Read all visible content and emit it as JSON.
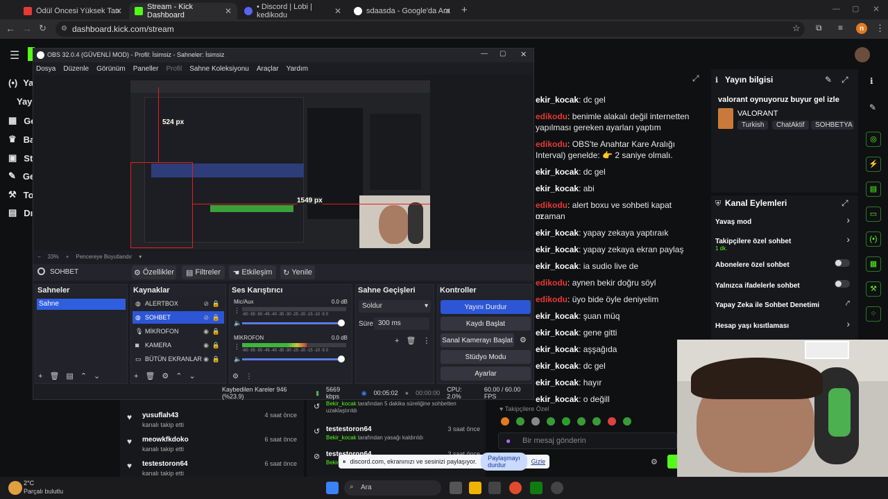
{
  "browser": {
    "tabs": [
      {
        "title": "Ödül Öncesi Yüksek Tansiyon! |",
        "color": "#e53935"
      },
      {
        "title": "Stream - Kick Dashboard",
        "color": "#53fc18"
      },
      {
        "title": "• Discord | Lobi | kedikodu",
        "color": "#5865f2"
      },
      {
        "title": "sdaasda - Google'da Ara",
        "color": "#ffffff"
      }
    ],
    "url": "dashboard.kick.com/stream",
    "profile_initial": "n"
  },
  "kick": {
    "sidebar": [
      "Yay",
      "Yayı",
      "Ge",
      "Ba",
      "St",
      "Ge",
      "To",
      "Dı"
    ],
    "chat": [
      {
        "user": "ekir_kocak",
        "color": "#ffffff",
        "msg": "dc gel"
      },
      {
        "user": "edikodu",
        "color": "#e53935",
        "msg": "benimle alakalı değil internetten"
      },
      {
        "user": "",
        "color": "#fff",
        "msg": "yapılması gereken ayarları yaptım"
      },
      {
        "user": "edikodu",
        "color": "#e53935",
        "msg": "OBS'te Anahtar Kare Aralığı"
      },
      {
        "user": "",
        "color": "#fff",
        "msg": "Interval) genelde: 👉 2 saniye olmalı."
      },
      {
        "user": "ekir_kocak",
        "color": "#ffffff",
        "msg": "dc gel"
      },
      {
        "user": "ekir_kocak",
        "color": "#ffffff",
        "msg": "abi"
      },
      {
        "user": "edikodu",
        "color": "#e53935",
        "msg": "alert boxu ve sohbeti kapat ozaman"
      },
      {
        "user": "",
        "color": "#fff",
        "msg": "m"
      },
      {
        "user": "ekir_kocak",
        "color": "#ffffff",
        "msg": "yapay zekaya yaptıraık"
      },
      {
        "user": "ekir_kocak",
        "color": "#ffffff",
        "msg": "yapay zekaya ekran paylaş"
      },
      {
        "user": "ekir_kocak",
        "color": "#ffffff",
        "msg": "ia sudio live de"
      },
      {
        "user": "edikodu",
        "color": "#e53935",
        "msg": "aynen bekir doğru söyl"
      },
      {
        "user": "edikodu",
        "color": "#e53935",
        "msg": "üyo bide öyle deniyelim"
      },
      {
        "user": "ekir_kocak",
        "color": "#ffffff",
        "msg": "şuan müq"
      },
      {
        "user": "ekir_kocak",
        "color": "#ffffff",
        "msg": "gene gitti"
      },
      {
        "user": "ekir_kocak",
        "color": "#ffffff",
        "msg": "aşşağıda"
      },
      {
        "user": "ekir_kocak",
        "color": "#ffffff",
        "msg": "dc gel"
      },
      {
        "user": "ekir_kocak",
        "color": "#ffffff",
        "msg": "hayır"
      },
      {
        "user": "ekir_kocak",
        "color": "#ffffff",
        "msg": "o değill"
      }
    ],
    "chat_input_placeholder": "Bir mesaj gönderin",
    "chat_followers_label": "Takipçilere Özel",
    "stream_info": {
      "heading": "Yayın bilgisi",
      "title": "valorant oynuyoruz buyur gel izle",
      "category": "VALORANT",
      "tags": [
        "Turkish",
        "ChatAktif",
        "SOHBETYA"
      ]
    },
    "channel_actions": {
      "heading": "Kanal Eylemleri",
      "items": [
        {
          "label": "Yavaş mod",
          "sub": "",
          "control": "arrow"
        },
        {
          "label": "Takipçilere özel sohbet",
          "sub": "1 dk.",
          "control": "arrow"
        },
        {
          "label": "Abonelere özel sohbet",
          "sub": "",
          "control": "toggle"
        },
        {
          "label": "Yalnızca ifadelerle sohbet",
          "sub": "",
          "control": "toggle"
        },
        {
          "label": "Yapay Zeka ile Sohbet Denetimi",
          "sub": "",
          "control": "external"
        },
        {
          "label": "Hesap yaşı kısıtlaması",
          "sub": "",
          "control": "arrow"
        }
      ]
    },
    "activity_left": [
      {
        "user": "yusuflah43",
        "action": "kanalı takip etti",
        "time": "4 saat önce"
      },
      {
        "user": "meowkfkdoko",
        "action": "kanalı takip etti",
        "time": "6 saat önce"
      },
      {
        "user": "testestoron64",
        "action": "kanalı takip etti",
        "time": "6 saat önce"
      }
    ],
    "activity_right": [
      {
        "user": "",
        "action": "tarafından 5 dakika süreliğine sohbetten uzaklaştırıldı",
        "by": "Bekir_kocak",
        "time": ""
      },
      {
        "user": "testestoron64",
        "action": "tarafından yasağı kaldırıldı",
        "by": "Bekir_kocak",
        "time": "3 saat önce"
      },
      {
        "user": "testestoron64",
        "action": "",
        "by": "Bekir_kocak",
        "time": "3 saat önce"
      }
    ]
  },
  "share_bar": {
    "text": "discord.com, ekranınızı ve sesinizi paylaşıyor.",
    "stop": "Paylaşmayı durdur",
    "hide": "Gizle"
  },
  "obs": {
    "title": "OBS 32.0.4 (GÜVENLİ MOD) - Profil: İsimsiz - Sahneler: İsimsiz",
    "menu": [
      "Dosya",
      "Düzenle",
      "Görünüm",
      "Paneller",
      "Profil",
      "Sahne Koleksiyonu",
      "Araçlar",
      "Yardım"
    ],
    "preview_labels": {
      "w": "524 px",
      "h": "1549 px"
    },
    "zoom": "33%",
    "fit": "Pencereye Boyutlandır",
    "source_bar": {
      "selected": "SOHBET",
      "props": "Özellikler",
      "filters": "Filtreler",
      "interact": "Etkileşim",
      "refresh": "Yenile"
    },
    "scenes": {
      "title": "Sahneler",
      "items": [
        "Sahne"
      ]
    },
    "sources": {
      "title": "Kaynaklar",
      "items": [
        "ALERTBOX",
        "SOHBET",
        "MİKROFON",
        "KAMERA",
        "BÜTÜN EKRANLAR"
      ]
    },
    "mixer": {
      "title": "Ses Karıştırıcı",
      "channels": [
        {
          "name": "Mic/Aux",
          "db": "0.0 dB",
          "level": 0.0
        },
        {
          "name": "MİKROFON",
          "db": "0.0 dB",
          "level": 0.62
        }
      ],
      "scale": "-60 -55 -50 -45 -40 -35 -30 -25 -20 -15 -10 -5 0"
    },
    "transitions": {
      "title": "Sahne Geçişleri",
      "type": "Soldur",
      "duration_label": "Süre",
      "duration": "300 ms"
    },
    "controls": {
      "title": "Kontroller",
      "buttons": [
        "Yayını Durdur",
        "Kaydı Başlat",
        "Sanal Kamerayı Başlat",
        "Stüdyo Modu",
        "Ayarlar"
      ]
    },
    "status": {
      "dropped": "Kaybedilen Kareler 946 (%23.9)",
      "kbps": "5669 kbps",
      "stream_time": "00:05:02",
      "rec_time": "00:00:00",
      "cpu": "CPU: 2.0%",
      "fps": "60.00 / 60.00 FPS"
    }
  },
  "taskbar": {
    "weather_temp": "2°C",
    "weather_desc": "Parçalı bulutlu",
    "search": "Ara"
  },
  "colors": {
    "kick_green": "#53fc18",
    "obs_blue": "#2c56d6",
    "accent": "#2f54c8"
  }
}
